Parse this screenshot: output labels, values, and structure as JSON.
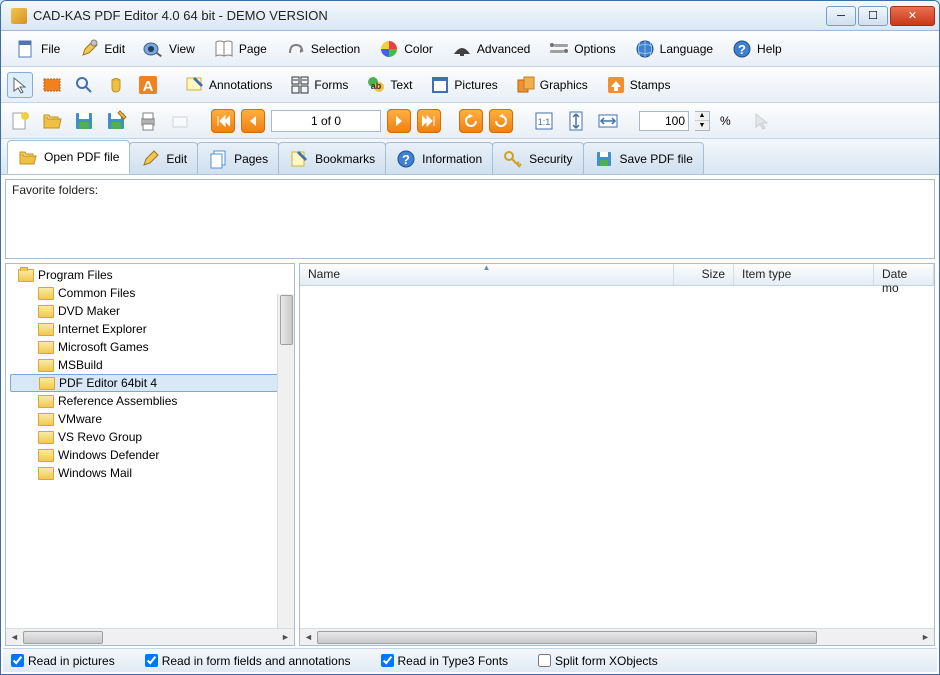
{
  "window": {
    "title": "CAD-KAS PDF Editor 4.0 64 bit - DEMO VERSION"
  },
  "menu": {
    "file": "File",
    "edit": "Edit",
    "view": "View",
    "page": "Page",
    "selection": "Selection",
    "color": "Color",
    "advanced": "Advanced",
    "options": "Options",
    "language": "Language",
    "help": "Help"
  },
  "tools": {
    "annotations": "Annotations",
    "forms": "Forms",
    "text": "Text",
    "pictures": "Pictures",
    "graphics": "Graphics",
    "stamps": "Stamps"
  },
  "nav": {
    "page_of": "1 of 0",
    "zoom": "100",
    "zoom_unit": "%"
  },
  "tabs": {
    "open": "Open PDF file",
    "edit": "Edit",
    "pages": "Pages",
    "bookmarks": "Bookmarks",
    "information": "Information",
    "security": "Security",
    "save": "Save PDF file"
  },
  "panels": {
    "favorite_folders": "Favorite folders:"
  },
  "tree": {
    "root": "Program Files",
    "children": [
      "Common Files",
      "DVD Maker",
      "Internet Explorer",
      "Microsoft Games",
      "MSBuild",
      "PDF Editor 64bit 4",
      "Reference Assemblies",
      "VMware",
      "VS Revo Group",
      "Windows Defender",
      "Windows Mail"
    ],
    "selected": "PDF Editor 64bit 4"
  },
  "list": {
    "cols": {
      "name": "Name",
      "size": "Size",
      "type": "Item type",
      "date": "Date mo"
    }
  },
  "checks": {
    "read_pictures": "Read in pictures",
    "read_forms": "Read in form fields and annotations",
    "read_type3": "Read in Type3 Fonts",
    "split_xobjects": "Split form XObjects"
  }
}
